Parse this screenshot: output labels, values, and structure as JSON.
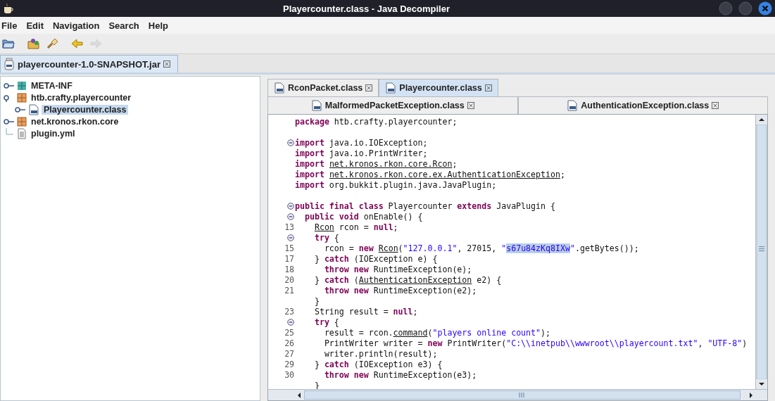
{
  "window": {
    "title": "Playercounter.class - Java Decompiler"
  },
  "menu": [
    "File",
    "Edit",
    "Navigation",
    "Search",
    "Help"
  ],
  "toolbar": [
    {
      "kind": "open",
      "disabled": false
    },
    {
      "kind": "open-type",
      "disabled": false
    },
    {
      "kind": "search",
      "disabled": false
    },
    {
      "kind": "back",
      "disabled": false
    },
    {
      "kind": "forward",
      "disabled": true
    }
  ],
  "file_tabs": [
    {
      "label": "playercounter-1.0-SNAPSHOT.jar",
      "selected": true
    }
  ],
  "tree": [
    {
      "label": "META-INF",
      "kind": "folder",
      "expanded": false,
      "selected": false
    },
    {
      "label": "htb.crafty.playercounter",
      "kind": "package",
      "expanded": true,
      "selected": false,
      "children": [
        {
          "label": "Playercounter.class",
          "kind": "class",
          "expanded": false,
          "selected": true
        }
      ]
    },
    {
      "label": "net.kronos.rkon.core",
      "kind": "package",
      "expanded": false,
      "selected": false
    },
    {
      "label": "plugin.yml",
      "kind": "file",
      "selected": false
    }
  ],
  "editor_tab_rows": [
    [
      {
        "label": "RconPacket.class",
        "selected": false
      },
      {
        "label": "Playercounter.class",
        "selected": true
      }
    ],
    [
      {
        "label": "MalformedPacketException.class",
        "selected": false
      },
      {
        "label": "AuthenticationException.class",
        "selected": false
      }
    ]
  ],
  "code": [
    {
      "foldable": false,
      "tokens": [
        {
          "kind": "kw",
          "text": "package"
        },
        {
          "kind": "text",
          "text": " htb.crafty.playercounter;"
        }
      ]
    },
    {
      "foldable": false
    },
    {
      "foldable": true,
      "tokens": [
        {
          "kind": "kw",
          "text": "import"
        },
        {
          "kind": "text",
          "text": " java.io.IOException;"
        }
      ]
    },
    {
      "foldable": false,
      "tokens": [
        {
          "kind": "kw",
          "text": "import"
        },
        {
          "kind": "text",
          "text": " java.io.PrintWriter;"
        }
      ]
    },
    {
      "foldable": false,
      "tokens": [
        {
          "kind": "kw",
          "text": "import"
        },
        {
          "kind": "link",
          "text": " net.kronos.rkon.core.Rcon"
        },
        {
          "kind": "text",
          "text": ";"
        }
      ]
    },
    {
      "foldable": false,
      "tokens": [
        {
          "kind": "kw",
          "text": "import"
        },
        {
          "kind": "link",
          "text": " net.kronos.rkon.core.ex.AuthenticationException"
        },
        {
          "kind": "text",
          "text": ";"
        }
      ]
    },
    {
      "foldable": false,
      "tokens": [
        {
          "kind": "kw",
          "text": "import"
        },
        {
          "kind": "text",
          "text": " org.bukkit.plugin.java.JavaPlugin;"
        }
      ]
    },
    {
      "foldable": false
    },
    {
      "foldable": true,
      "tokens": [
        {
          "kind": "kw",
          "text": "public final class"
        },
        {
          "kind": "text",
          "text": " Playercounter "
        },
        {
          "kind": "kw",
          "text": "extends"
        },
        {
          "kind": "text",
          "text": " JavaPlugin {"
        }
      ]
    },
    {
      "foldable": true,
      "tokens": [
        {
          "kind": "kw",
          "text": "  public void"
        },
        {
          "kind": "text",
          "text": " onEnable() {"
        }
      ]
    },
    {
      "number": "13",
      "foldable": false,
      "tokens": [
        {
          "kind": "link",
          "text": "    Rcon"
        },
        {
          "kind": "text",
          "text": " rcon = "
        },
        {
          "kind": "kw",
          "text": "null"
        },
        {
          "kind": "text",
          "text": ";"
        }
      ]
    },
    {
      "foldable": true,
      "tokens": [
        {
          "kind": "kw",
          "text": "    try"
        },
        {
          "kind": "text",
          "text": " {"
        }
      ]
    },
    {
      "number": "15",
      "foldable": false,
      "tokens": [
        {
          "kind": "text",
          "text": "      rcon = "
        },
        {
          "kind": "kw",
          "text": "new"
        },
        {
          "kind": "link",
          "text": " Rcon"
        },
        {
          "kind": "text",
          "text": "("
        },
        {
          "kind": "str",
          "text": "\"127.0.0.1\""
        },
        {
          "kind": "text",
          "text": ", 27015, "
        },
        {
          "kind": "str",
          "text": "\""
        },
        {
          "kind": "sel",
          "text": "s67u84zKq8IXw"
        },
        {
          "kind": "str",
          "text": "\""
        },
        {
          "kind": "text",
          "text": ".getBytes());"
        }
      ]
    },
    {
      "number": "17",
      "foldable": false,
      "tokens": [
        {
          "kind": "text",
          "text": "    } "
        },
        {
          "kind": "kw",
          "text": "catch"
        },
        {
          "kind": "text",
          "text": " (IOException e) {"
        }
      ]
    },
    {
      "number": "18",
      "foldable": false,
      "tokens": [
        {
          "kind": "kw",
          "text": "      throw new"
        },
        {
          "kind": "text",
          "text": " RuntimeException(e);"
        }
      ]
    },
    {
      "number": "20",
      "foldable": false,
      "tokens": [
        {
          "kind": "text",
          "text": "    } "
        },
        {
          "kind": "kw",
          "text": "catch"
        },
        {
          "kind": "text",
          "text": " ("
        },
        {
          "kind": "link",
          "text": "AuthenticationException"
        },
        {
          "kind": "text",
          "text": " e2) {"
        }
      ]
    },
    {
      "number": "21",
      "foldable": false,
      "tokens": [
        {
          "kind": "kw",
          "text": "      throw new"
        },
        {
          "kind": "text",
          "text": " RuntimeException(e2);"
        }
      ]
    },
    {
      "foldable": false,
      "tokens": [
        {
          "kind": "text",
          "text": "    }"
        }
      ]
    },
    {
      "number": "23",
      "foldable": false,
      "tokens": [
        {
          "kind": "text",
          "text": "    String result = "
        },
        {
          "kind": "kw",
          "text": "null"
        },
        {
          "kind": "text",
          "text": ";"
        }
      ]
    },
    {
      "foldable": true,
      "tokens": [
        {
          "kind": "kw",
          "text": "    try"
        },
        {
          "kind": "text",
          "text": " {"
        }
      ]
    },
    {
      "number": "25",
      "foldable": false,
      "tokens": [
        {
          "kind": "text",
          "text": "      result = rcon."
        },
        {
          "kind": "link",
          "text": "command"
        },
        {
          "kind": "text",
          "text": "("
        },
        {
          "kind": "str",
          "text": "\"players online count\""
        },
        {
          "kind": "text",
          "text": ");"
        }
      ]
    },
    {
      "number": "26",
      "foldable": false,
      "tokens": [
        {
          "kind": "text",
          "text": "      PrintWriter writer = "
        },
        {
          "kind": "kw",
          "text": "new"
        },
        {
          "kind": "text",
          "text": " PrintWriter("
        },
        {
          "kind": "str",
          "text": "\"C:\\\\inetpub\\\\wwwroot\\\\playercount.txt\""
        },
        {
          "kind": "text",
          "text": ", "
        },
        {
          "kind": "str",
          "text": "\"UTF-8\""
        },
        {
          "kind": "text",
          "text": ")"
        }
      ]
    },
    {
      "number": "27",
      "foldable": false,
      "tokens": [
        {
          "kind": "text",
          "text": "      writer.println(result);"
        }
      ]
    },
    {
      "number": "29",
      "foldable": false,
      "tokens": [
        {
          "kind": "text",
          "text": "    } "
        },
        {
          "kind": "kw",
          "text": "catch"
        },
        {
          "kind": "text",
          "text": " (IOException e3) {"
        }
      ]
    },
    {
      "number": "30",
      "foldable": false,
      "tokens": [
        {
          "kind": "kw",
          "text": "      throw new"
        },
        {
          "kind": "text",
          "text": " RuntimeException(e3);"
        }
      ]
    },
    {
      "foldable": false,
      "tokens": [
        {
          "kind": "text",
          "text": "    }"
        }
      ]
    }
  ]
}
